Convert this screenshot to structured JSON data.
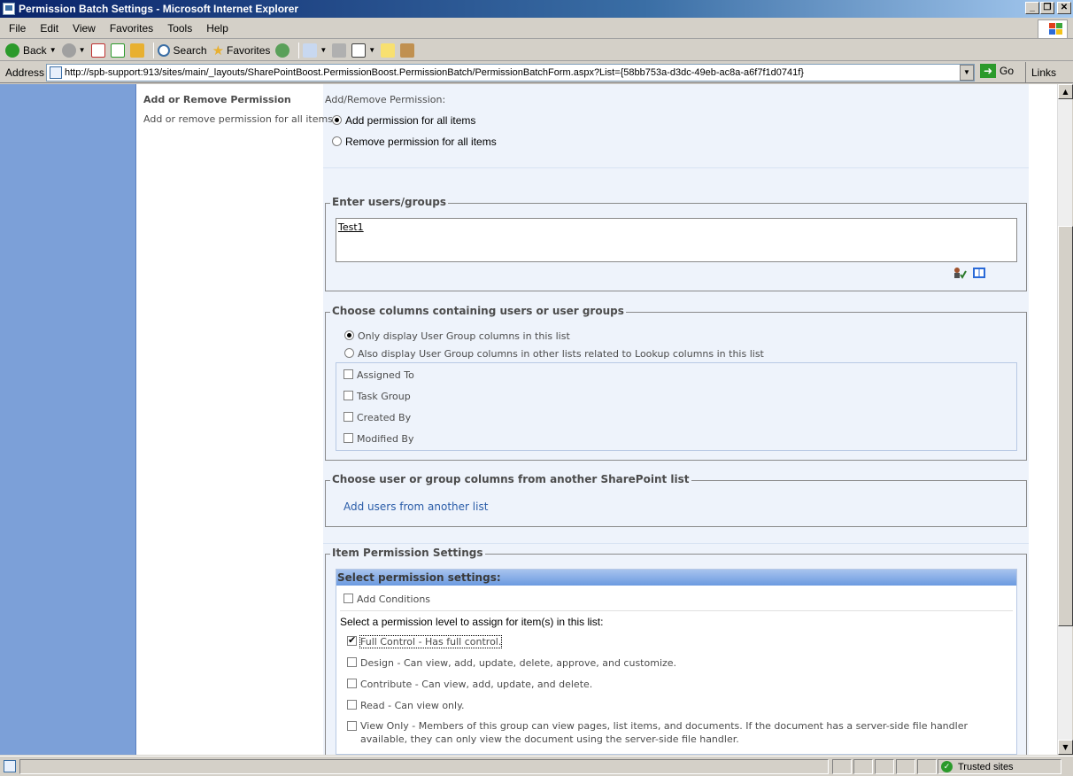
{
  "window": {
    "title": "Permission Batch Settings - Microsoft Internet Explorer",
    "buttons": {
      "minimize": "_",
      "restore": "❐",
      "close": "✕"
    }
  },
  "menu": [
    "File",
    "Edit",
    "View",
    "Favorites",
    "Tools",
    "Help"
  ],
  "toolbar": {
    "back": "Back",
    "search": "Search",
    "favorites": "Favorites"
  },
  "address": {
    "label": "Address",
    "url": "http://spb-support:913/sites/main/_layouts/SharePointBoost.PermissionBoost.PermissionBatch/PermissionBatchForm.aspx?List={58bb753a-d3dc-49eb-ac8a-a6f7f1d0741f}",
    "go": "Go",
    "links": "Links"
  },
  "section": {
    "title": "Add or Remove Permission",
    "description": "Add or remove permission for all items"
  },
  "add_remove": {
    "label": "Add/Remove Permission:",
    "options": [
      {
        "label": "Add permission for all items",
        "checked": true
      },
      {
        "label": "Remove permission for all items",
        "checked": false
      }
    ]
  },
  "users_groups": {
    "legend": "Enter users/groups",
    "value": "Test1"
  },
  "choose_columns": {
    "legend": "Choose columns containing users or user groups",
    "radio_options": [
      {
        "label": "Only display User Group columns in this list",
        "checked": true
      },
      {
        "label": "Also display User Group columns in other lists related to Lookup columns in this list",
        "checked": false
      }
    ],
    "columns": [
      "Assigned To",
      "Task Group",
      "Created By",
      "Modified By"
    ]
  },
  "other_list": {
    "legend": "Choose user or group columns from another SharePoint list",
    "link": "Add users from another list"
  },
  "item_permission": {
    "legend": "Item Permission Settings",
    "header": "Select permission settings:",
    "add_conditions": "Add Conditions",
    "intro": "Select a permission level to assign for item(s) in this list:",
    "levels": [
      {
        "label": "Full Control - Has full control.",
        "checked": true
      },
      {
        "label": "Design - Can view, add, update, delete, approve, and customize.",
        "checked": false
      },
      {
        "label": "Contribute - Can view, add, update, and delete.",
        "checked": false
      },
      {
        "label": "Read - Can view only.",
        "checked": false
      },
      {
        "label": "View Only - Members of this group can view pages, list items, and documents. If the document has a server-side file handler available, they can only view the document using the server-side file handler.",
        "checked": false
      }
    ]
  },
  "status": {
    "zone": "Trusted sites"
  }
}
